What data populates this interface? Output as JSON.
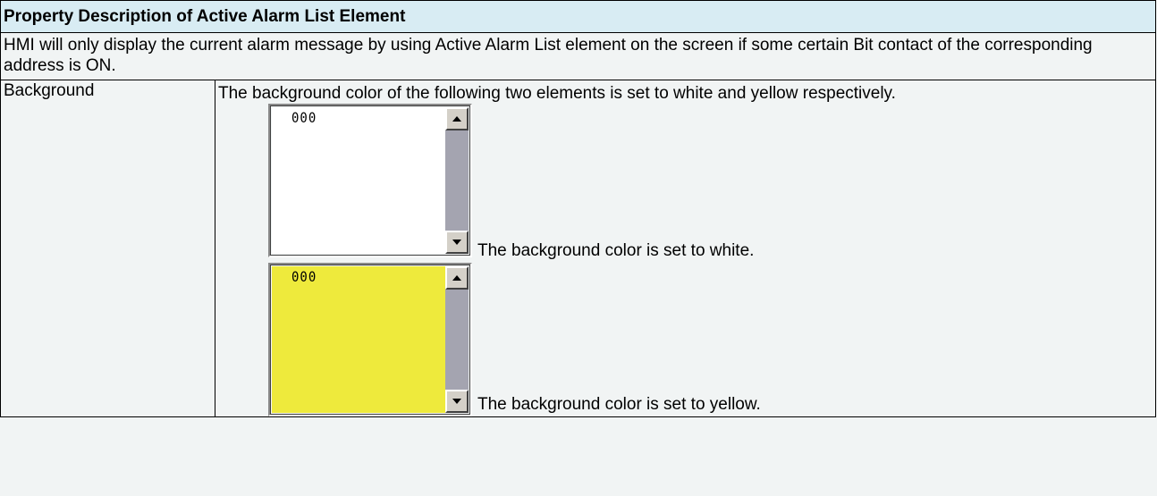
{
  "header": {
    "title": "Property Description of Active Alarm List Element"
  },
  "intro": {
    "text": "HMI will only display the current alarm message by using Active Alarm List element on the screen if some certain Bit contact of the corresponding address is ON."
  },
  "background_row": {
    "label": "Background",
    "description": "The background color of the following two elements is set to white and yellow respectively.",
    "examples": [
      {
        "item_text": "000",
        "bg_color": "#ffffff",
        "caption": "The background color is set to white."
      },
      {
        "item_text": "000",
        "bg_color": "#eeea3c",
        "caption": "The background color is set to yellow."
      }
    ]
  },
  "colors": {
    "header_bg": "#d8ecf3",
    "page_bg": "#f1f4f4",
    "scrollbar_track": "#a4a4b0"
  }
}
